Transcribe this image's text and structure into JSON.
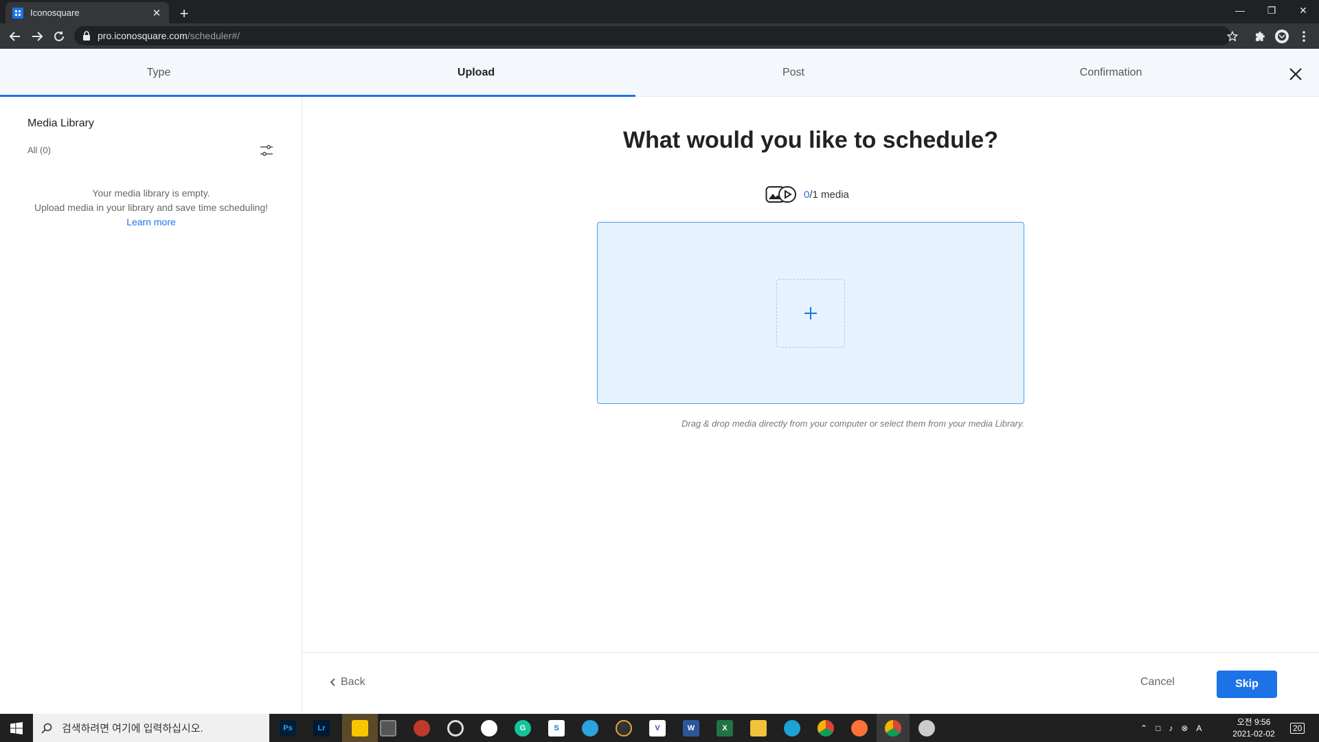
{
  "browser": {
    "tab_title": "Iconosquare",
    "url_host": "pro.iconosquare.com",
    "url_path": "/scheduler#/"
  },
  "steps": [
    {
      "label": "Type",
      "active": false
    },
    {
      "label": "Upload",
      "active": true
    },
    {
      "label": "Post",
      "active": false
    },
    {
      "label": "Confirmation",
      "active": false
    }
  ],
  "step_progress": 0.5,
  "sidebar": {
    "title": "Media Library",
    "filter_all": "All (0)",
    "empty_line1": "Your media library is empty.",
    "empty_line2": "Upload media in your library and save time scheduling!",
    "learn_more": "Learn more"
  },
  "main": {
    "heading": "What would you like to schedule?",
    "media_count_current": "0",
    "media_count_rest": "/1 media",
    "hint": "Drag & drop media directly from your computer or select them from your media Library."
  },
  "footer": {
    "back": "Back",
    "cancel": "Cancel",
    "skip": "Skip"
  },
  "taskbar": {
    "search_placeholder": "검색하려면 여기에 입력하십시오.",
    "time": "오전 9:56",
    "date": "2021-02-02",
    "notification_count": "20",
    "ime": "A"
  },
  "colors": {
    "accent": "#1c73e8",
    "dropzone_bg": "#e6f2ff"
  },
  "icons": [
    "iconosquare-favicon",
    "close-tab-icon",
    "new-tab-icon",
    "back-icon",
    "forward-icon",
    "reload-icon",
    "lock-icon",
    "star-icon",
    "extensions-icon",
    "profile-icon",
    "menu-icon",
    "close-icon",
    "filter-icon",
    "media-icon",
    "plus-icon",
    "chevron-left-icon",
    "windows-icon",
    "search-icon"
  ]
}
